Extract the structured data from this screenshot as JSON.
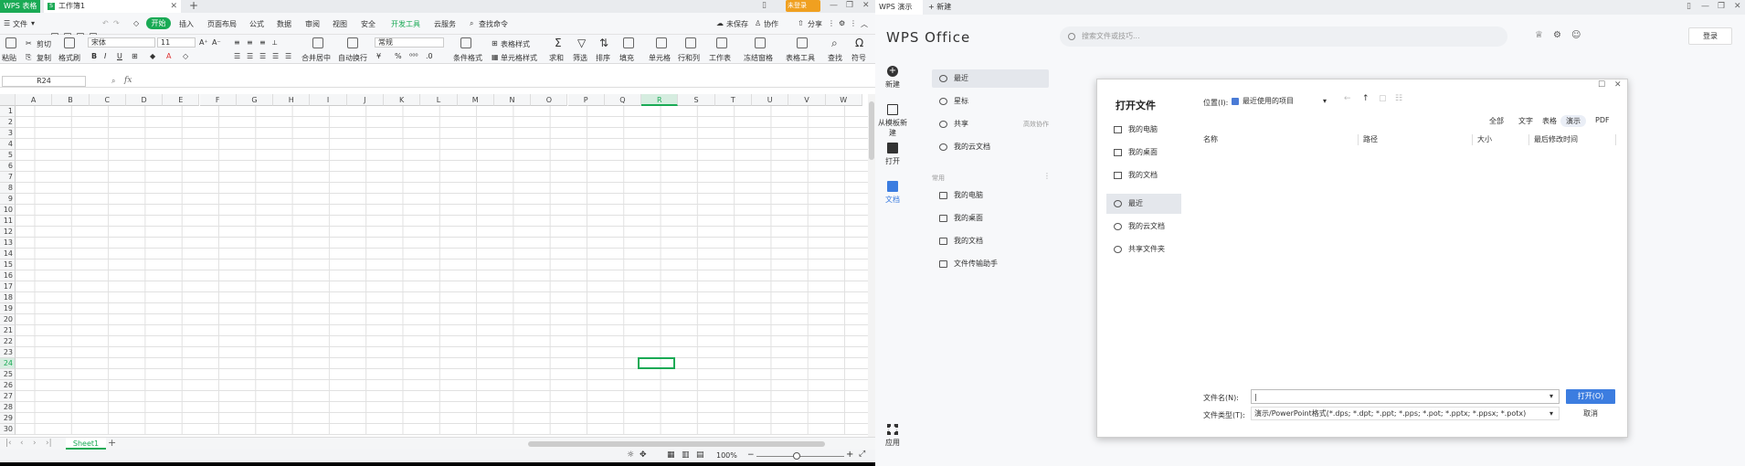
{
  "et": {
    "app_tab": "WPS 表格",
    "doc_tab": "工作簿1",
    "doc_icon": "S",
    "menu": {
      "file": "文件",
      "items": [
        "开始",
        "插入",
        "页面布局",
        "公式",
        "数据",
        "审阅",
        "视图",
        "安全",
        "开发工具",
        "云服务"
      ],
      "search": "查找命令",
      "unsaved": "未保存",
      "collab": "协作",
      "share": "分享",
      "login": "未登录"
    },
    "ribbon": {
      "paste": "粘贴",
      "cut": "剪切",
      "copy": "复制",
      "format_painter": "格式刷",
      "font_name": "宋体",
      "font_size": "11",
      "number_format": "常规",
      "merge": "合并居中",
      "wrap": "自动换行",
      "cond_format": "条件格式",
      "table_style": "表格样式",
      "cell_style": "单元格样式",
      "sum": "求和",
      "filter": "筛选",
      "sort": "排序",
      "fill": "填充",
      "cell": "单元格",
      "row_col": "行和列",
      "worksheet": "工作表",
      "freeze": "冻结窗格",
      "table_tools": "表格工具",
      "find": "查找",
      "symbol": "符号"
    },
    "name_box": "R24",
    "fx": "fx",
    "columns": [
      "A",
      "B",
      "C",
      "D",
      "E",
      "F",
      "G",
      "H",
      "I",
      "J",
      "K",
      "L",
      "M",
      "N",
      "O",
      "P",
      "Q",
      "R",
      "S",
      "T",
      "U",
      "V",
      "W"
    ],
    "active_col": "R",
    "rows": [
      "1",
      "2",
      "3",
      "4",
      "5",
      "6",
      "7",
      "8",
      "9",
      "10",
      "11",
      "12",
      "13",
      "14",
      "15",
      "16",
      "17",
      "18",
      "19",
      "20",
      "21",
      "22",
      "23",
      "24",
      "25",
      "26",
      "27",
      "28",
      "29",
      "30"
    ],
    "active_row": "24",
    "sheet_tab": "Sheet1",
    "zoom": "100%"
  },
  "wpp": {
    "app_tab": "WPS 演示",
    "new_tab": "新建",
    "logo": "WPS Office",
    "search_placeholder": "搜索文件或技巧...",
    "login": "登录",
    "left_nav": [
      "新建",
      "从模板新建",
      "打开",
      "文档"
    ],
    "apps": "应用",
    "sub_nav": {
      "recent": "最近",
      "star": "星标",
      "shared": "共享",
      "shared_hint": "高效协作",
      "cloud": "我的云文档",
      "common": "常用",
      "my_pc": "我的电脑",
      "desktop": "我的桌面",
      "my_docs": "我的文档",
      "transfer": "文件传输助手"
    },
    "dialog": {
      "title": "打开文件",
      "nav": [
        "我的电脑",
        "我的桌面",
        "我的文档",
        "最近",
        "我的云文档",
        "共享文件夹"
      ],
      "location_label": "位置(I):",
      "location_value": "最近使用的项目",
      "filters": [
        "全部",
        "文字",
        "表格",
        "演示",
        "PDF"
      ],
      "columns": [
        "名称",
        "路径",
        "大小",
        "最后修改时间"
      ],
      "filename_label": "文件名(N):",
      "filename_value": "",
      "filetype_label": "文件类型(T):",
      "filetype_value": "演示/PowerPoint格式(*.dps; *.dpt; *.ppt; *.pps; *.pot; *.pptx; *.ppsx; *.potx)",
      "open": "打开(O)",
      "cancel": "取消"
    }
  },
  "colors": {
    "et_green": "#1aaa55",
    "wpp_blue": "#3c7de0",
    "login_orange": "#f0a020"
  }
}
